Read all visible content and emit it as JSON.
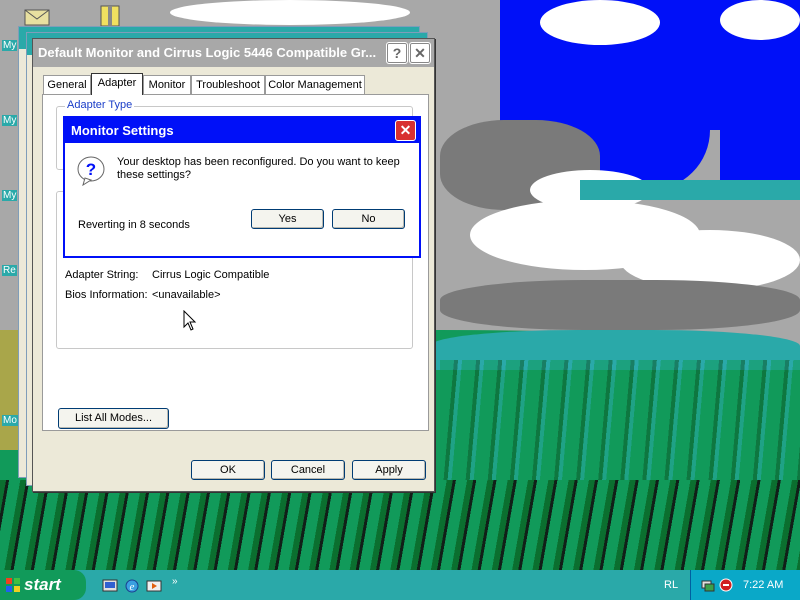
{
  "desktop": {
    "icon_labels": [
      "My",
      "My",
      "My",
      "Re",
      "Mo"
    ]
  },
  "properties_window": {
    "title": "Default Monitor and Cirrus Logic 5446 Compatible Gr...",
    "help_label": "?",
    "close_label": "✕",
    "tabs": [
      {
        "label": "General"
      },
      {
        "label": "Adapter"
      },
      {
        "label": "Monitor"
      },
      {
        "label": "Troubleshoot"
      },
      {
        "label": "Color Management"
      }
    ],
    "active_tab": "Adapter",
    "adapter_type_group": "Adapter Type",
    "adapter_string_label": "Adapter String:",
    "adapter_string_value": "Cirrus Logic Compatible",
    "bios_info_label": "Bios Information:",
    "bios_info_value": "<unavailable>",
    "list_all_modes_label": "List All Modes...",
    "ok_label": "OK",
    "cancel_label": "Cancel",
    "apply_label": "Apply"
  },
  "monitor_settings_dialog": {
    "title": "Monitor Settings",
    "close_label": "✕",
    "message": "Your desktop has been reconfigured.  Do you want to keep these settings?",
    "reverting_text": "Reverting in 8 seconds",
    "yes_label": "Yes",
    "no_label": "No"
  },
  "taskbar": {
    "start_label": "start",
    "toolbar_label": "RL",
    "clock": "7:22 AM"
  },
  "colors": {
    "dialog_title": "#0010f8",
    "taskbar": "#2aa9a9",
    "start_button": "#119a5a",
    "tray": "#0aa8c8"
  },
  "icons": [
    "mail-icon",
    "zip-folder-icon",
    "question-icon",
    "close-icon",
    "help-icon",
    "windows-logo-icon",
    "show-desktop-icon",
    "internet-explorer-icon",
    "media-player-icon",
    "network-tray-icon",
    "security-tray-icon",
    "mouse-cursor-icon"
  ]
}
